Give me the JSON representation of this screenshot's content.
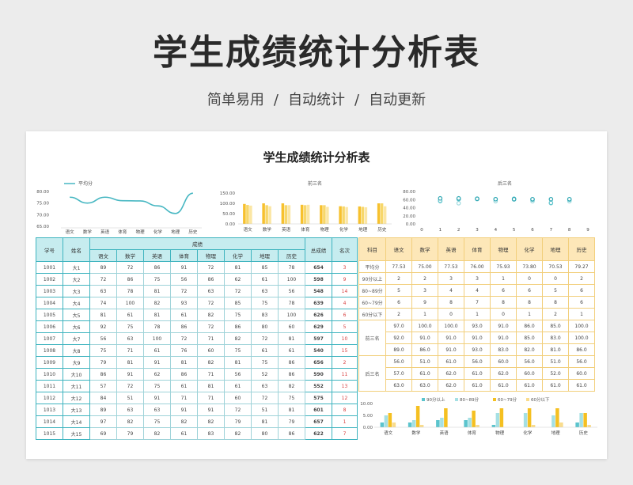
{
  "banner": {
    "title": "学生成绩统计分析表",
    "sub_1": "简单易用",
    "sep": "/",
    "sub_2": "自动统计",
    "sub_3": "自动更新"
  },
  "sheet_title": "学生成绩统计分析表",
  "subjects": [
    "语文",
    "数学",
    "英语",
    "体育",
    "物理",
    "化学",
    "地理",
    "历史"
  ],
  "left_table": {
    "h_id": "学号",
    "h_name": "姓名",
    "h_scores": "成绩",
    "h_total": "总成绩",
    "h_rank": "名次",
    "rows": [
      [
        "1001",
        "大1",
        "89",
        "72",
        "86",
        "91",
        "72",
        "81",
        "85",
        "78",
        "654",
        "3"
      ],
      [
        "1002",
        "大2",
        "72",
        "86",
        "75",
        "56",
        "86",
        "62",
        "61",
        "100",
        "598",
        "9"
      ],
      [
        "1003",
        "大3",
        "63",
        "78",
        "81",
        "72",
        "63",
        "72",
        "63",
        "56",
        "548",
        "14"
      ],
      [
        "1004",
        "大4",
        "74",
        "100",
        "82",
        "93",
        "72",
        "85",
        "75",
        "78",
        "639",
        "4"
      ],
      [
        "1005",
        "大5",
        "81",
        "61",
        "81",
        "61",
        "82",
        "75",
        "83",
        "100",
        "626",
        "6"
      ],
      [
        "1006",
        "大6",
        "92",
        "75",
        "78",
        "86",
        "72",
        "86",
        "80",
        "60",
        "629",
        "5"
      ],
      [
        "1007",
        "大7",
        "56",
        "63",
        "100",
        "72",
        "71",
        "82",
        "72",
        "81",
        "597",
        "10"
      ],
      [
        "1008",
        "大8",
        "75",
        "71",
        "61",
        "76",
        "60",
        "75",
        "61",
        "61",
        "540",
        "15"
      ],
      [
        "1009",
        "大9",
        "79",
        "81",
        "91",
        "81",
        "82",
        "81",
        "75",
        "86",
        "656",
        "2"
      ],
      [
        "1010",
        "大10",
        "86",
        "91",
        "62",
        "86",
        "71",
        "56",
        "52",
        "86",
        "590",
        "11"
      ],
      [
        "1011",
        "大11",
        "57",
        "72",
        "75",
        "61",
        "81",
        "61",
        "63",
        "82",
        "552",
        "13"
      ],
      [
        "1012",
        "大12",
        "84",
        "51",
        "91",
        "71",
        "71",
        "60",
        "72",
        "75",
        "575",
        "12"
      ],
      [
        "1013",
        "大13",
        "89",
        "63",
        "63",
        "91",
        "91",
        "72",
        "51",
        "81",
        "601",
        "8"
      ],
      [
        "1014",
        "大14",
        "97",
        "82",
        "75",
        "82",
        "82",
        "79",
        "81",
        "79",
        "657",
        "1"
      ],
      [
        "1015",
        "大15",
        "69",
        "79",
        "82",
        "61",
        "83",
        "82",
        "80",
        "86",
        "622",
        "7"
      ]
    ]
  },
  "right_table": {
    "h_item": "科目",
    "stats": [
      {
        "label": "平均分",
        "values": [
          "77.53",
          "75.00",
          "77.53",
          "76.00",
          "75.93",
          "73.80",
          "70.53",
          "79.27"
        ]
      },
      {
        "label": "90分以上",
        "values": [
          "2",
          "2",
          "3",
          "3",
          "1",
          "0",
          "0",
          "2"
        ]
      },
      {
        "label": "80~89分",
        "values": [
          "5",
          "3",
          "4",
          "4",
          "6",
          "6",
          "5",
          "6"
        ]
      },
      {
        "label": "60~79分",
        "values": [
          "6",
          "9",
          "8",
          "7",
          "8",
          "8",
          "8",
          "6"
        ]
      },
      {
        "label": "60分以下",
        "values": [
          "2",
          "1",
          "0",
          "1",
          "0",
          "1",
          "2",
          "1"
        ]
      }
    ],
    "top_label": "前三名",
    "top": [
      [
        "97.0",
        "100.0",
        "100.0",
        "93.0",
        "91.0",
        "86.0",
        "85.0",
        "100.0"
      ],
      [
        "92.0",
        "91.0",
        "91.0",
        "91.0",
        "91.0",
        "85.0",
        "83.0",
        "100.0"
      ],
      [
        "89.0",
        "86.0",
        "91.0",
        "93.0",
        "83.0",
        "82.0",
        "81.0",
        "86.0"
      ]
    ],
    "bottom_label": "后三名",
    "bottom": [
      [
        "56.0",
        "51.0",
        "61.0",
        "56.0",
        "60.0",
        "56.0",
        "51.0",
        "56.0"
      ],
      [
        "57.0",
        "61.0",
        "62.0",
        "61.0",
        "62.0",
        "60.0",
        "52.0",
        "60.0"
      ],
      [
        "63.0",
        "63.0",
        "62.0",
        "61.0",
        "61.0",
        "61.0",
        "61.0",
        "61.0"
      ]
    ]
  },
  "chart_data": [
    {
      "type": "line",
      "legend": "平均分",
      "categories": [
        "语文",
        "数学",
        "英语",
        "体育",
        "物理",
        "化学",
        "地理",
        "历史"
      ],
      "values": [
        77.53,
        75.0,
        77.53,
        76.0,
        75.93,
        73.8,
        70.53,
        79.27
      ],
      "ylim": [
        65,
        80
      ],
      "yticks": [
        "80.00",
        "75.00",
        "70.00",
        "65.00"
      ],
      "color": "#47b7c2"
    },
    {
      "type": "bar",
      "title": "前三名",
      "categories": [
        "语文",
        "数学",
        "英语",
        "体育",
        "物理",
        "化学",
        "地理",
        "历史"
      ],
      "series": [
        {
          "values": [
            97,
            100,
            100,
            93,
            91,
            86,
            85,
            100
          ]
        },
        {
          "values": [
            92,
            91,
            91,
            91,
            91,
            85,
            83,
            100
          ]
        },
        {
          "values": [
            89,
            86,
            91,
            93,
            83,
            82,
            81,
            86
          ]
        }
      ],
      "ylim": [
        0,
        150
      ],
      "yticks": [
        "150.00",
        "100.00",
        "50.00",
        "0.00"
      ],
      "colors": [
        "#f7c12e",
        "#f7d76a",
        "#fbe6a4"
      ]
    },
    {
      "type": "scatter",
      "title": "后三名",
      "x": [
        1,
        2,
        3,
        4,
        5,
        6,
        7,
        8
      ],
      "series": [
        {
          "values": [
            56,
            51,
            61,
            56,
            60,
            56,
            51,
            56
          ]
        },
        {
          "values": [
            57,
            61,
            62,
            61,
            62,
            60,
            52,
            60
          ]
        },
        {
          "values": [
            63,
            63,
            62,
            61,
            61,
            61,
            61,
            61
          ]
        }
      ],
      "ylim": [
        0,
        80
      ],
      "xlim": [
        0,
        9
      ],
      "yticks": [
        "80.00",
        "60.00",
        "40.00",
        "20.00",
        "0.00"
      ],
      "xticks": [
        "0",
        "1",
        "2",
        "3",
        "4",
        "5",
        "6",
        "7",
        "8",
        "9"
      ],
      "colors": [
        "#9ed9de",
        "#5ec3cc",
        "#2fa7b3"
      ]
    },
    {
      "type": "bar",
      "categories": [
        "语文",
        "数学",
        "英语",
        "体育",
        "物理",
        "化学",
        "地理",
        "历史"
      ],
      "series": [
        {
          "name": "90分以上",
          "values": [
            2,
            2,
            3,
            3,
            1,
            0,
            0,
            2
          ],
          "color": "#5bc4cd"
        },
        {
          "name": "80~89分",
          "values": [
            5,
            3,
            4,
            4,
            6,
            6,
            5,
            6
          ],
          "color": "#a5e0e4"
        },
        {
          "name": "60~79分",
          "values": [
            6,
            9,
            8,
            7,
            8,
            8,
            8,
            6
          ],
          "color": "#f5c021"
        },
        {
          "name": "60分以下",
          "values": [
            2,
            1,
            0,
            1,
            0,
            1,
            2,
            1
          ],
          "color": "#f9dc8d"
        }
      ],
      "ylim": [
        0,
        10
      ],
      "yticks": [
        "10.00",
        "5.00",
        "0.00"
      ]
    }
  ]
}
